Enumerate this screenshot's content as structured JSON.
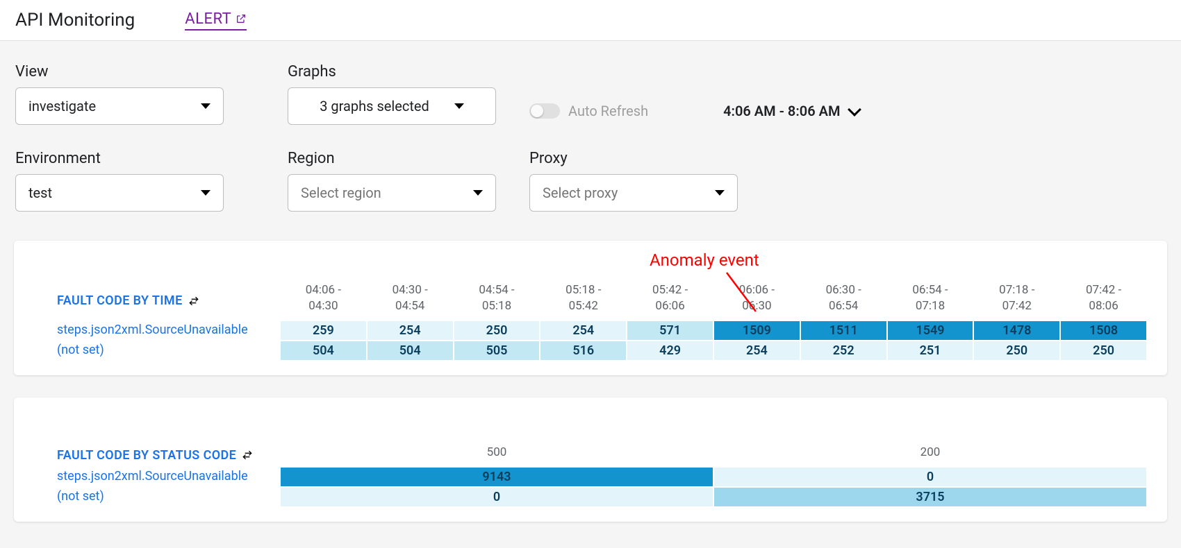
{
  "header": {
    "title": "API Monitoring",
    "alert_label": "ALERT"
  },
  "filters": {
    "view_label": "View",
    "view_value": "investigate",
    "graphs_label": "Graphs",
    "graphs_value": "3 graphs selected",
    "autorefresh_label": "Auto Refresh",
    "timerange": "4:06 AM - 8:06 AM",
    "env_label": "Environment",
    "env_value": "test",
    "region_label": "Region",
    "region_placeholder": "Select region",
    "proxy_label": "Proxy",
    "proxy_placeholder": "Select proxy"
  },
  "annotation": {
    "label": "Anomaly event"
  },
  "card_time": {
    "title": "FAULT CODE BY TIME",
    "time_buckets": [
      "04:06 - 04:30",
      "04:30 - 04:54",
      "04:54 - 05:18",
      "05:18 - 05:42",
      "05:42 - 06:06",
      "06:06 - 06:30",
      "06:30 - 06:54",
      "06:54 - 07:18",
      "07:18 - 07:42",
      "07:42 - 08:06"
    ],
    "rows": [
      {
        "label": "steps.json2xml.SourceUnavailable",
        "values": [
          259,
          254,
          250,
          254,
          571,
          1509,
          1511,
          1549,
          1478,
          1508
        ]
      },
      {
        "label": "(not set)",
        "values": [
          504,
          504,
          505,
          516,
          429,
          254,
          252,
          251,
          250,
          250
        ]
      }
    ]
  },
  "card_status": {
    "title": "FAULT CODE BY STATUS CODE",
    "status_codes": [
      "500",
      "200"
    ],
    "rows": [
      {
        "label": "steps.json2xml.SourceUnavailable",
        "values": [
          9143,
          0
        ]
      },
      {
        "label": "(not set)",
        "values": [
          0,
          3715
        ]
      }
    ]
  },
  "colors": {
    "heat": [
      "#e3f5fb",
      "#c2e8f3",
      "#9cd7ed",
      "#6bc6e6",
      "#32aadb",
      "#1394cf"
    ]
  }
}
